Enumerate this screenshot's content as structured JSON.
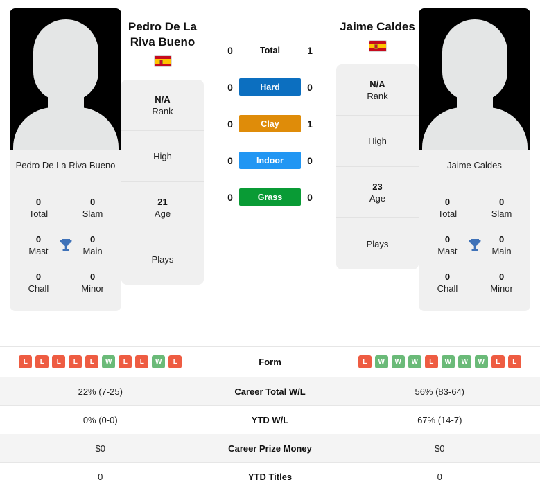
{
  "colors": {
    "hard": "#0c6fc0",
    "clay": "#df8c09",
    "indoor": "#2196f3",
    "grass": "#099b35",
    "win": "#6aba78",
    "loss": "#ee5c42",
    "card_bg": "#f0f0f0",
    "row_shade": "#f4f4f4"
  },
  "players": {
    "left": {
      "name": "Pedro De La Riva Bueno",
      "photo_caption": "Pedro De La Riva Bueno",
      "country": "Spain",
      "flag": "spain-flag",
      "titles": [
        {
          "value": "0",
          "label": "Total"
        },
        {
          "value": "0",
          "label": "Slam"
        },
        {
          "value": "0",
          "label": "Mast"
        },
        {
          "value": "0",
          "label": "Main"
        },
        {
          "value": "0",
          "label": "Chall"
        },
        {
          "value": "0",
          "label": "Minor"
        }
      ],
      "rank_cells": [
        {
          "value": "N/A",
          "label": "Rank"
        },
        {
          "value": "",
          "label": "High"
        },
        {
          "value": "21",
          "label": "Age"
        },
        {
          "value": "",
          "label": "Plays"
        }
      ],
      "form": [
        "L",
        "L",
        "L",
        "L",
        "L",
        "W",
        "L",
        "L",
        "W",
        "L"
      ],
      "career_total_wl": "22% (7-25)",
      "ytd_wl": "0% (0-0)",
      "career_prize_money": "$0",
      "ytd_titles": "0"
    },
    "right": {
      "name": "Jaime Caldes",
      "photo_caption": "Jaime Caldes",
      "country": "Spain",
      "flag": "spain-flag",
      "titles": [
        {
          "value": "0",
          "label": "Total"
        },
        {
          "value": "0",
          "label": "Slam"
        },
        {
          "value": "0",
          "label": "Mast"
        },
        {
          "value": "0",
          "label": "Main"
        },
        {
          "value": "0",
          "label": "Chall"
        },
        {
          "value": "0",
          "label": "Minor"
        }
      ],
      "rank_cells": [
        {
          "value": "N/A",
          "label": "Rank"
        },
        {
          "value": "",
          "label": "High"
        },
        {
          "value": "23",
          "label": "Age"
        },
        {
          "value": "",
          "label": "Plays"
        }
      ],
      "form": [
        "L",
        "W",
        "W",
        "W",
        "L",
        "W",
        "W",
        "W",
        "L",
        "L"
      ],
      "career_total_wl": "56% (83-64)",
      "ytd_wl": "67% (14-7)",
      "career_prize_money": "$0",
      "ytd_titles": "0"
    }
  },
  "head_to_head": {
    "rows": [
      {
        "surface": "Total",
        "left": "0",
        "right": "1",
        "style": "plain"
      },
      {
        "surface": "Hard",
        "left": "0",
        "right": "0",
        "style": "hard"
      },
      {
        "surface": "Clay",
        "left": "0",
        "right": "1",
        "style": "clay"
      },
      {
        "surface": "Indoor",
        "left": "0",
        "right": "0",
        "style": "indoor"
      },
      {
        "surface": "Grass",
        "left": "0",
        "right": "0",
        "style": "grass"
      }
    ]
  },
  "stats_rows": [
    {
      "label": "Form",
      "left": "",
      "right": ""
    },
    {
      "label": "Career Total W/L",
      "left": "22% (7-25)",
      "right": "56% (83-64)"
    },
    {
      "label": "YTD W/L",
      "left": "0% (0-0)",
      "right": "67% (14-7)"
    },
    {
      "label": "Career Prize Money",
      "left": "$0",
      "right": "$0"
    },
    {
      "label": "YTD Titles",
      "left": "0",
      "right": "0"
    }
  ]
}
